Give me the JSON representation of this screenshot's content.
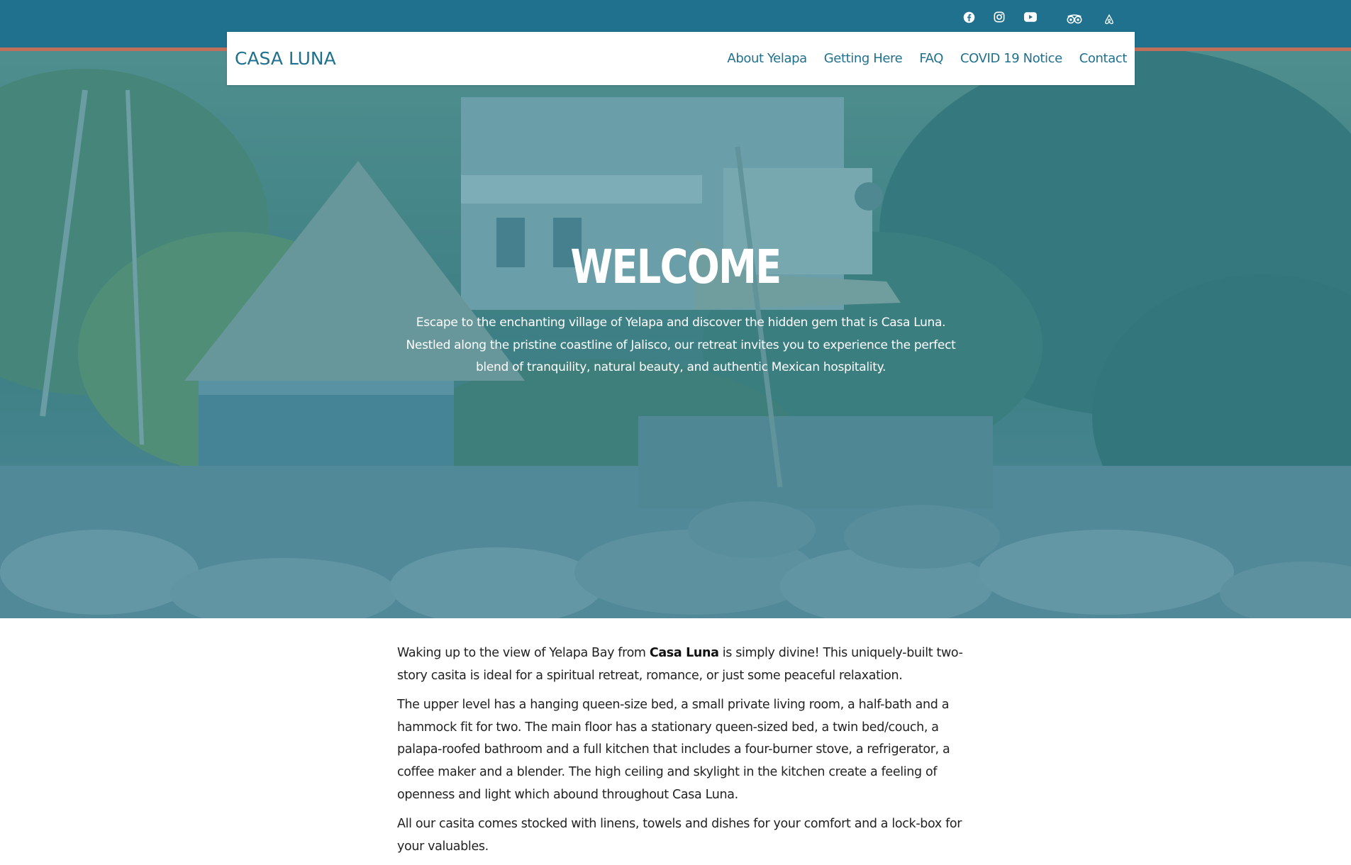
{
  "site": {
    "brand": "CASA LUNA",
    "nav": [
      "About Yelapa",
      "Getting Here",
      "FAQ",
      "COVID 19 Notice",
      "Contact"
    ],
    "social_icons": [
      "facebook-icon",
      "instagram-icon",
      "youtube-icon",
      "tripadvisor-icon",
      "airbnb-icon"
    ]
  },
  "hero": {
    "title": "WELCOME",
    "intro": "Escape to the enchanting village of Yelapa and discover the hidden gem that is Casa Luna. Nestled along the pristine coastline of Jalisco, our retreat invites you to experience the perfect blend of tranquility, natural beauty, and authentic Mexican hospitality."
  },
  "content": {
    "p1_before": "Waking up to the view of Yelapa Bay from ",
    "p1_bold": "Casa Luna",
    "p1_after": " is simply divine! This uniquely-built two-story casita is ideal for a spiritual retreat, romance, or just some peaceful relaxation.",
    "p2": "The upper level has a hanging queen-size bed, a small private living room, a half-bath and a hammock fit for two. The main floor has a stationary queen-sized bed, a twin bed/couch, a palapa-roofed bathroom and a full kitchen that includes a four-burner stove, a refrigerator, a coffee maker and a blender. The high ceiling and skylight in the kitchen create a feeling of openness and light which abound throughout Casa Luna.",
    "p3": "All our casita comes stocked with linens, towels and dishes for your comfort and a lock-box for your valuables."
  },
  "colors": {
    "primary": "#20718d",
    "accent_stripe": "#c0705a",
    "hero_overlay": "#2a8098"
  }
}
